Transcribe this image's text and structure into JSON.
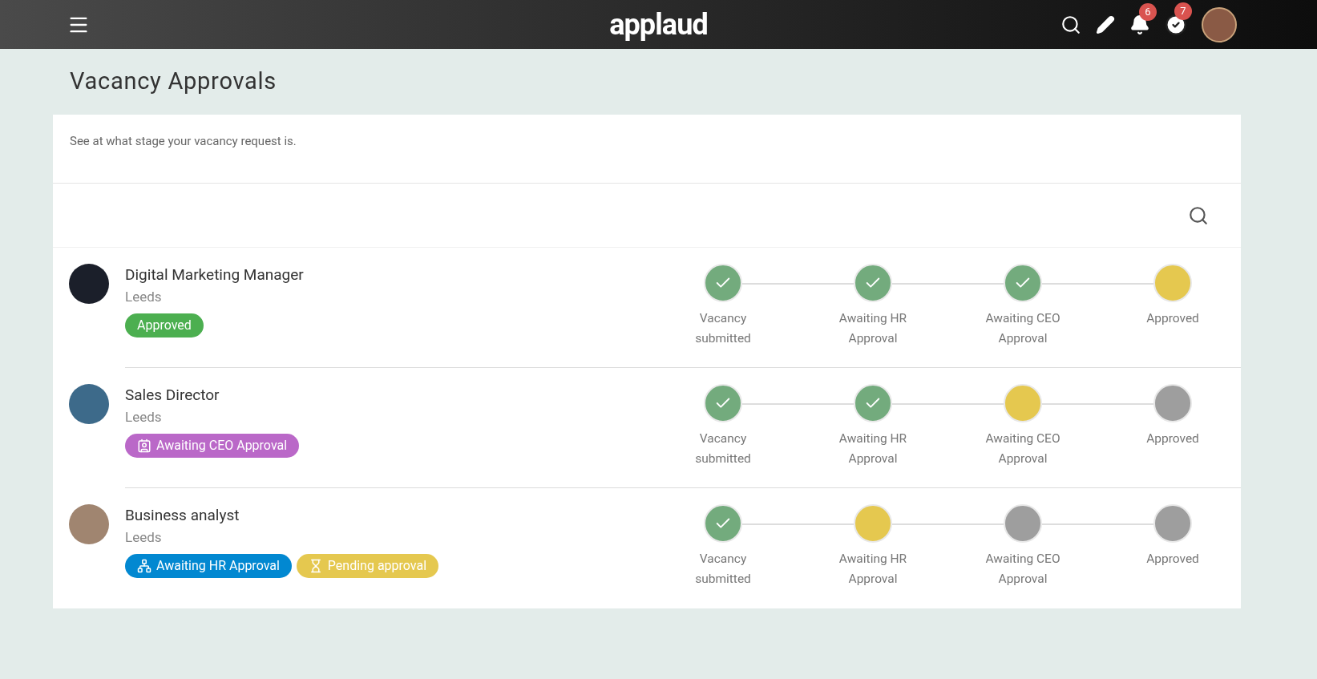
{
  "header": {
    "logo": "applaud",
    "notifications_count": "6",
    "tasks_count": "7"
  },
  "page": {
    "title": "Vacancy Approvals",
    "description": "See at what stage your vacancy request is."
  },
  "vacancies": [
    {
      "title": "Digital Marketing Manager",
      "location": "Leeds",
      "tags": [
        {
          "kind": "approved",
          "label": "Approved",
          "color": "#4caf50"
        }
      ],
      "steps": [
        {
          "label": "Vacancy submitted",
          "completed": true,
          "active": false
        },
        {
          "label": "Awaiting HR Approval",
          "completed": true,
          "active": false
        },
        {
          "label": "Awaiting CEO Approval",
          "completed": true,
          "active": false
        },
        {
          "label": "Approved",
          "completed": false,
          "active": true
        }
      ]
    },
    {
      "title": "Sales Director",
      "location": "Leeds",
      "tags": [
        {
          "kind": "ceo",
          "label": "Awaiting CEO Approval",
          "color": "#ba68c8"
        }
      ],
      "steps": [
        {
          "label": "Vacancy submitted",
          "completed": true,
          "active": false
        },
        {
          "label": "Awaiting HR Approval",
          "completed": true,
          "active": false
        },
        {
          "label": "Awaiting CEO Approval",
          "completed": false,
          "active": true
        },
        {
          "label": "Approved",
          "completed": false,
          "active": false
        }
      ]
    },
    {
      "title": "Business analyst",
      "location": "Leeds",
      "tags": [
        {
          "kind": "hr",
          "label": "Awaiting HR Approval",
          "color": "#0288d1"
        },
        {
          "kind": "pending",
          "label": "Pending approval",
          "color": "#e5c84f"
        }
      ],
      "steps": [
        {
          "label": "Vacancy submitted",
          "completed": true,
          "active": false
        },
        {
          "label": "Awaiting HR Approval",
          "completed": false,
          "active": true
        },
        {
          "label": "Awaiting CEO Approval",
          "completed": false,
          "active": false
        },
        {
          "label": "Approved",
          "completed": false,
          "active": false
        }
      ]
    }
  ]
}
